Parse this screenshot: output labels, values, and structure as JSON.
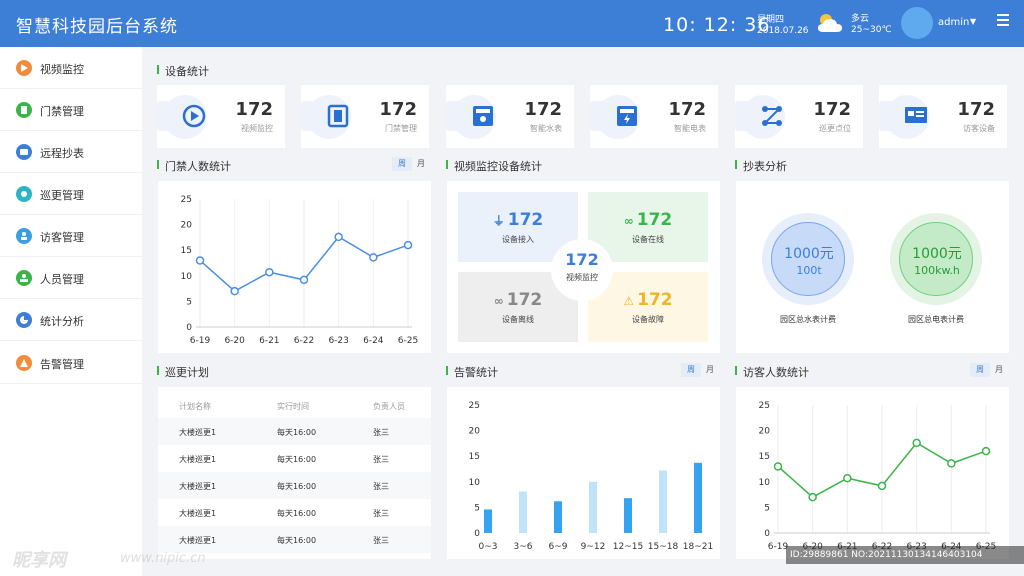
{
  "header": {
    "title": "智慧科技园后台系统",
    "time": {
      "h": "10",
      "m": "12",
      "s": "36"
    },
    "weekday": "星期四",
    "date": "2018.07.26",
    "weather": {
      "icon": "partly-cloudy-icon",
      "desc": "多云",
      "temp": "25~30℃"
    },
    "user": "admin",
    "accent": "#3d7fd6"
  },
  "sidebar": {
    "items": [
      {
        "label": "视频监控",
        "icon": "video-icon",
        "color": "#f08c3b"
      },
      {
        "label": "门禁管理",
        "icon": "door-icon",
        "color": "#3bb54a"
      },
      {
        "label": "远程抄表",
        "icon": "meter-icon",
        "color": "#3d7fd6"
      },
      {
        "label": "巡更管理",
        "icon": "patrol-icon",
        "color": "#2bb5c4"
      },
      {
        "label": "访客管理",
        "icon": "visitor-icon",
        "color": "#3d9fe0"
      },
      {
        "label": "人员管理",
        "icon": "people-icon",
        "color": "#3bb54a"
      },
      {
        "label": "统计分析",
        "icon": "pie-icon",
        "color": "#3d7fd6"
      },
      {
        "label": "告警管理",
        "icon": "alarm-icon",
        "color": "#f08c3b"
      }
    ]
  },
  "sections": {
    "devices": "设备统计",
    "access": "门禁人数统计",
    "video": "视频监控设备统计",
    "meter": "抄表分析",
    "patrol": "巡更计划",
    "alarm": "告警统计",
    "visitor": "访客人数统计"
  },
  "toggle": {
    "week": "周",
    "month": "月"
  },
  "device_stats": [
    {
      "value": "172",
      "label": "视频监控",
      "icon": "camera-ai-icon"
    },
    {
      "value": "172",
      "label": "门禁管理",
      "icon": "door-access-icon"
    },
    {
      "value": "172",
      "label": "智能水表",
      "icon": "water-meter-icon"
    },
    {
      "value": "172",
      "label": "智能电表",
      "icon": "electric-meter-icon"
    },
    {
      "value": "172",
      "label": "巡更点位",
      "icon": "patrol-point-icon"
    },
    {
      "value": "172",
      "label": "访客设备",
      "icon": "visitor-device-icon"
    }
  ],
  "video_stats": {
    "center": {
      "value": "172",
      "label": "视频监控"
    },
    "quads": [
      {
        "value": "172",
        "label": "设备接入",
        "icon": "plug-icon",
        "color": "#3d7fd6",
        "bg": "#eaf1fb"
      },
      {
        "value": "172",
        "label": "设备在线",
        "icon": "link-icon",
        "color": "#3bb54a",
        "bg": "#e8f6ea"
      },
      {
        "value": "172",
        "label": "设备离线",
        "icon": "broken-link-icon",
        "color": "#888888",
        "bg": "#eeeeee"
      },
      {
        "value": "172",
        "label": "设备故障",
        "icon": "warning-icon",
        "color": "#f0b429",
        "bg": "#fdf7e4"
      }
    ]
  },
  "meter": {
    "water": {
      "value": "1000元",
      "unit": "100t",
      "label": "园区总水表计费"
    },
    "electric": {
      "value": "1000元",
      "unit": "100kw.h",
      "label": "园区总电表计费"
    }
  },
  "patrol": {
    "headers": [
      "计划名称",
      "实行时间",
      "负责人员"
    ],
    "rows": [
      [
        "大楼巡更1",
        "每天16:00",
        "张三"
      ],
      [
        "大楼巡更1",
        "每天16:00",
        "张三"
      ],
      [
        "大楼巡更1",
        "每天16:00",
        "张三"
      ],
      [
        "大楼巡更1",
        "每天16:00",
        "张三"
      ],
      [
        "大楼巡更1",
        "每天16:00",
        "张三"
      ]
    ]
  },
  "chart_data": [
    {
      "type": "line",
      "title": "门禁人数统计",
      "x": [
        "6-19",
        "6-20",
        "6-21",
        "6-22",
        "6-23",
        "6-24",
        "6-25"
      ],
      "values": [
        13,
        7,
        10.7,
        9.2,
        17.6,
        13.6,
        16
      ],
      "ylim": [
        0,
        25
      ],
      "yticks": [
        0,
        5,
        10,
        15,
        20,
        25
      ],
      "color": "#4a8ee8",
      "grid": "vertical"
    },
    {
      "type": "bar",
      "title": "告警统计",
      "categories": [
        "0~3",
        "3~6",
        "6~9",
        "9~12",
        "12~15",
        "15~18",
        "18~21"
      ],
      "values": [
        4.6,
        8.1,
        6.2,
        10,
        6.8,
        12.2,
        13.7
      ],
      "ylim": [
        0,
        25
      ],
      "yticks": [
        0,
        5,
        10,
        15,
        20,
        25
      ],
      "colors": [
        "#36a3f0",
        "#bfe3f8",
        "#36a3f0",
        "#bfe3f8",
        "#36a3f0",
        "#bfe3f8",
        "#36a3f0"
      ]
    },
    {
      "type": "line",
      "title": "访客人数统计",
      "x": [
        "6-19",
        "6-20",
        "6-21",
        "6-22",
        "6-23",
        "6-24",
        "6-25"
      ],
      "values": [
        13,
        7,
        10.7,
        9.2,
        17.6,
        13.6,
        16
      ],
      "ylim": [
        0,
        25
      ],
      "yticks": [
        0,
        5,
        10,
        15,
        20,
        25
      ],
      "color": "#3bb54a",
      "grid": "vertical"
    }
  ],
  "watermark": {
    "brand": "昵享网",
    "site": "www.nipic.cn",
    "id_text": "ID:29889861 NO:20211130134146403104"
  }
}
